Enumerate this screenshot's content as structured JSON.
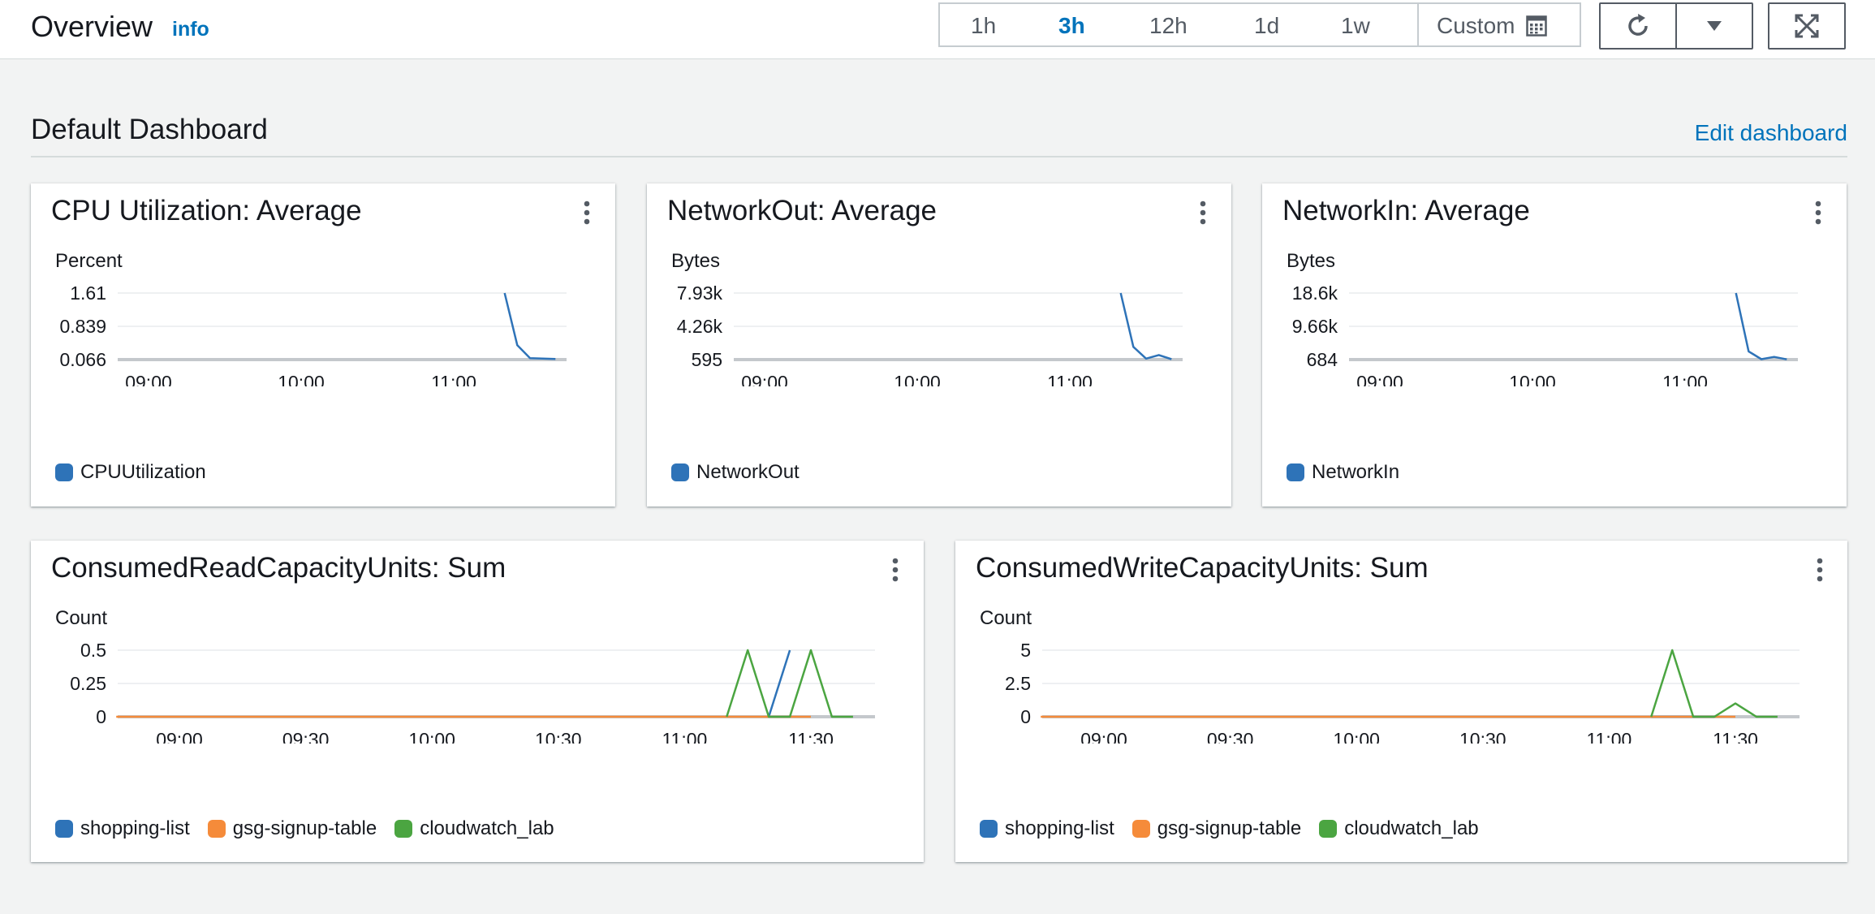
{
  "header": {
    "title": "Overview",
    "info_label": "info",
    "ranges": [
      "1h",
      "3h",
      "12h",
      "1d",
      "1w"
    ],
    "active_range": "3h",
    "custom_label": "Custom"
  },
  "dashboard": {
    "title": "Default Dashboard",
    "edit_label": "Edit dashboard"
  },
  "colors": {
    "series_blue": "#2e73b8",
    "series_orange": "#f58b3a",
    "series_green": "#4ba541",
    "link": "#0073bb"
  },
  "panels": [
    {
      "title": "CPU Utilization: Average",
      "unit": "Percent",
      "legend": [
        {
          "name": "CPUUtilization",
          "color": "#2e73b8"
        }
      ],
      "chart_data": {
        "type": "line",
        "x_ticks": [
          "09:00",
          "10:00",
          "11:00"
        ],
        "y_ticks": [
          "1.61",
          "0.839",
          "0.066"
        ],
        "ylim": [
          0.066,
          1.61
        ],
        "series": [
          {
            "name": "CPUUtilization",
            "color": "#2e73b8",
            "points": [
              [
                "11:20",
                1.61
              ],
              [
                "11:25",
                0.4
              ],
              [
                "11:30",
                0.1
              ],
              [
                "11:40",
                0.08
              ]
            ]
          }
        ]
      }
    },
    {
      "title": "NetworkOut: Average",
      "unit": "Bytes",
      "legend": [
        {
          "name": "NetworkOut",
          "color": "#2e73b8"
        }
      ],
      "chart_data": {
        "type": "line",
        "x_ticks": [
          "09:00",
          "10:00",
          "11:00"
        ],
        "y_ticks": [
          "7.93k",
          "4.26k",
          "595"
        ],
        "ylim": [
          595,
          7930
        ],
        "series": [
          {
            "name": "NetworkOut",
            "color": "#2e73b8",
            "points": [
              [
                "11:20",
                7930
              ],
              [
                "11:25",
                2000
              ],
              [
                "11:30",
                700
              ],
              [
                "11:35",
                1100
              ],
              [
                "11:40",
                640
              ]
            ]
          }
        ]
      }
    },
    {
      "title": "NetworkIn: Average",
      "unit": "Bytes",
      "legend": [
        {
          "name": "NetworkIn",
          "color": "#2e73b8"
        }
      ],
      "chart_data": {
        "type": "line",
        "x_ticks": [
          "09:00",
          "10:00",
          "11:00"
        ],
        "y_ticks": [
          "18.6k",
          "9.66k",
          "684"
        ],
        "ylim": [
          684,
          18600
        ],
        "series": [
          {
            "name": "NetworkIn",
            "color": "#2e73b8",
            "points": [
              [
                "11:20",
                18600
              ],
              [
                "11:25",
                2900
              ],
              [
                "11:30",
                800
              ],
              [
                "11:35",
                1400
              ],
              [
                "11:40",
                750
              ]
            ]
          }
        ]
      }
    },
    {
      "title": "ConsumedReadCapacityUnits: Sum",
      "unit": "Count",
      "legend": [
        {
          "name": "shopping-list",
          "color": "#2e73b8"
        },
        {
          "name": "gsg-signup-table",
          "color": "#f58b3a"
        },
        {
          "name": "cloudwatch_lab",
          "color": "#4ba541"
        }
      ],
      "chart_data": {
        "type": "line",
        "x_ticks": [
          "09:00",
          "09:30",
          "10:00",
          "10:30",
          "11:00",
          "11:30"
        ],
        "y_ticks": [
          "0.5",
          "0.25",
          "0"
        ],
        "ylim": [
          0,
          0.5
        ],
        "series": [
          {
            "name": "shopping-list",
            "color": "#2e73b8",
            "points": [
              [
                "11:20",
                0
              ],
              [
                "11:25",
                0.5
              ]
            ]
          },
          {
            "name": "gsg-signup-table",
            "color": "#f58b3a",
            "points": [
              [
                "08:45",
                0
              ],
              [
                "11:30",
                0
              ]
            ]
          },
          {
            "name": "cloudwatch_lab",
            "color": "#4ba541",
            "points": [
              [
                "11:10",
                0
              ],
              [
                "11:15",
                0.5
              ],
              [
                "11:20",
                0
              ],
              [
                "11:25",
                0
              ],
              [
                "11:30",
                0.5
              ],
              [
                "11:35",
                0
              ],
              [
                "11:40",
                0
              ]
            ]
          }
        ]
      }
    },
    {
      "title": "ConsumedWriteCapacityUnits: Sum",
      "unit": "Count",
      "legend": [
        {
          "name": "shopping-list",
          "color": "#2e73b8"
        },
        {
          "name": "gsg-signup-table",
          "color": "#f58b3a"
        },
        {
          "name": "cloudwatch_lab",
          "color": "#4ba541"
        }
      ],
      "chart_data": {
        "type": "line",
        "x_ticks": [
          "09:00",
          "09:30",
          "10:00",
          "10:30",
          "11:00",
          "11:30"
        ],
        "y_ticks": [
          "5",
          "2.5",
          "0"
        ],
        "ylim": [
          0,
          5
        ],
        "series": [
          {
            "name": "shopping-list",
            "color": "#2e73b8",
            "points": [
              [
                "11:10",
                0
              ],
              [
                "11:25",
                0
              ]
            ]
          },
          {
            "name": "gsg-signup-table",
            "color": "#f58b3a",
            "points": [
              [
                "08:45",
                0
              ],
              [
                "11:30",
                0
              ]
            ]
          },
          {
            "name": "cloudwatch_lab",
            "color": "#4ba541",
            "points": [
              [
                "11:10",
                0
              ],
              [
                "11:15",
                5
              ],
              [
                "11:20",
                0
              ],
              [
                "11:25",
                0
              ],
              [
                "11:30",
                1
              ],
              [
                "11:35",
                0
              ],
              [
                "11:40",
                0
              ]
            ]
          }
        ]
      }
    }
  ]
}
